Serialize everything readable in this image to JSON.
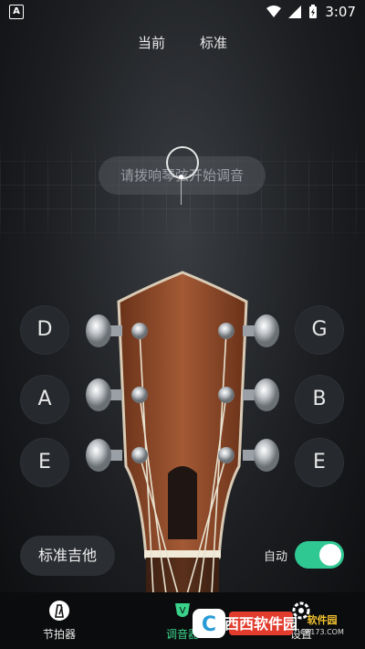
{
  "status_bar": {
    "app_icon_letter": "A",
    "time": "3:07"
  },
  "tabs": [
    {
      "label": "当前"
    },
    {
      "label": "标准"
    }
  ],
  "hint": "请拨响琴弦开始调音",
  "strings": {
    "left": [
      "D",
      "A",
      "E"
    ],
    "right": [
      "G",
      "B",
      "E"
    ]
  },
  "tuning_button": "标准吉他",
  "auto": {
    "label": "自动",
    "enabled": true
  },
  "nav": [
    {
      "label": "节拍器",
      "icon": "metronome-icon"
    },
    {
      "label": "调音器",
      "icon": "tuner-icon",
      "active": true
    },
    {
      "label": "设置",
      "icon": "settings-icon"
    }
  ],
  "watermark": {
    "brand": "西西软件园",
    "url": "CR173.COM"
  },
  "colors": {
    "accent": "#2fc892",
    "headstock": "#8a4a2c",
    "button_bg": "#26292d"
  }
}
